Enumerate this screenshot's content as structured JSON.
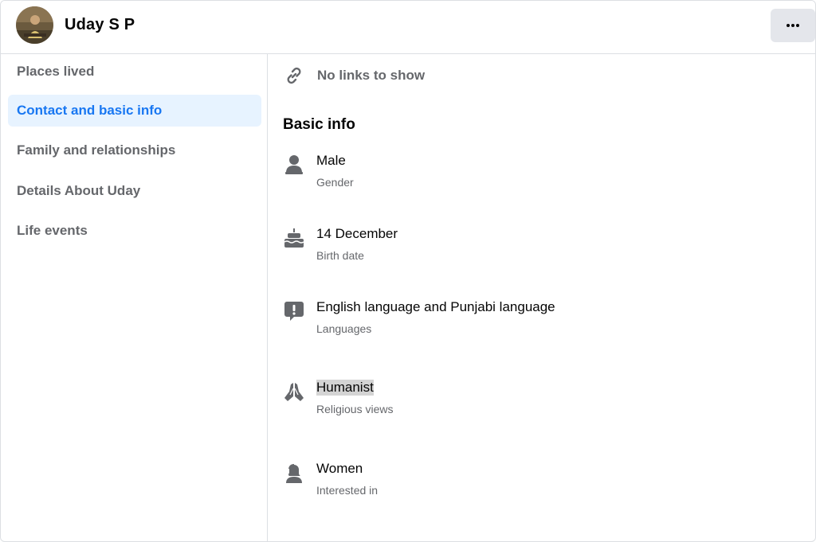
{
  "header": {
    "name": "Uday S P",
    "avatar_icon": "profile-avatar",
    "more_icon": "more-horizontal-icon"
  },
  "sidebar": {
    "items": [
      {
        "label": "Places lived",
        "active": false
      },
      {
        "label": "Contact and basic info",
        "active": true
      },
      {
        "label": "Family and relationships",
        "active": false
      },
      {
        "label": "Details About Uday",
        "active": false
      },
      {
        "label": "Life events",
        "active": false
      }
    ]
  },
  "main": {
    "links": {
      "text": "No links to show",
      "icon": "link-icon"
    },
    "basic_info_title": "Basic info",
    "rows": [
      {
        "value": "Male",
        "label": "Gender",
        "icon": "gender-icon"
      },
      {
        "value": "14 December",
        "label": "Birth date",
        "icon": "birthday-cake-icon"
      },
      {
        "value": "English language and Punjabi language",
        "label": "Languages",
        "icon": "languages-icon"
      },
      {
        "value": "Humanist",
        "label": "Religious views",
        "icon": "praying-hands-icon"
      },
      {
        "value": "Women",
        "label": "Interested in",
        "icon": "interested-in-icon"
      }
    ]
  },
  "colors": {
    "accent": "#1877f2",
    "active_bg": "#e7f3ff",
    "muted_text": "#65676b",
    "icon_gray": "#65676b",
    "border": "#dcdfe3"
  }
}
